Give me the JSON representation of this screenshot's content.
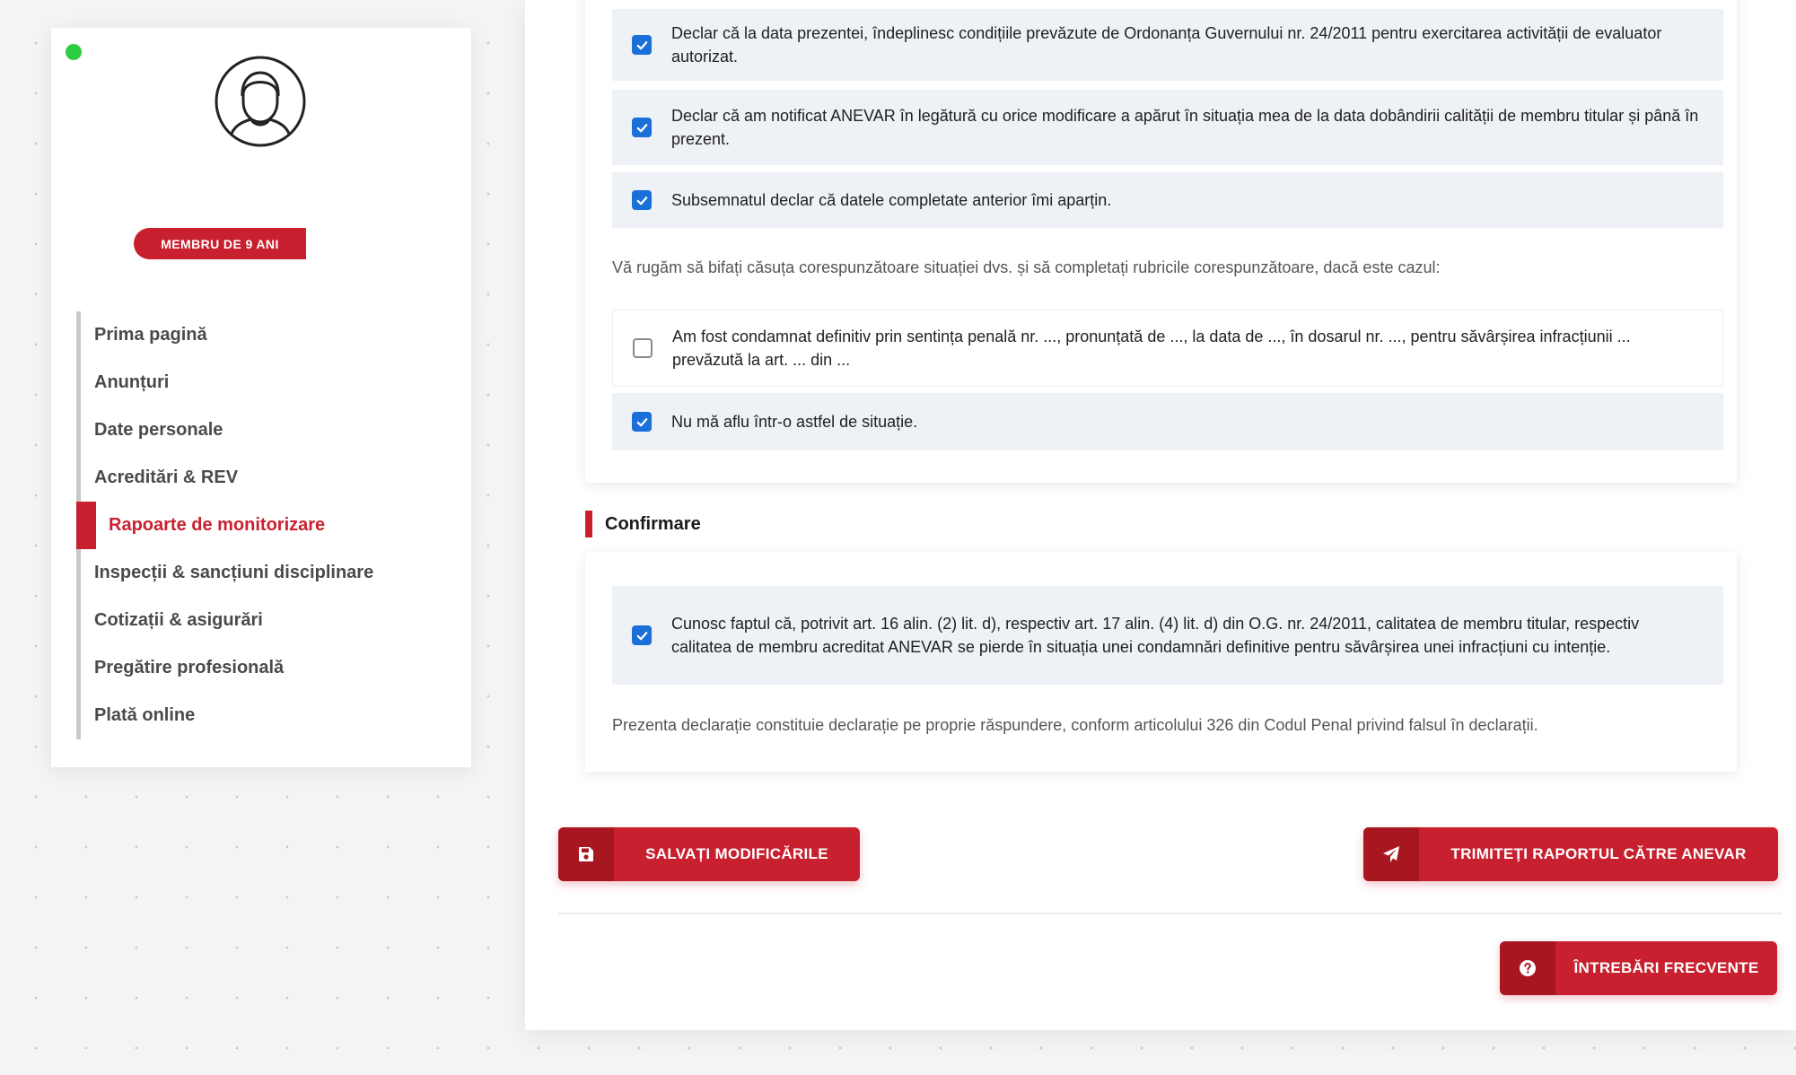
{
  "sidebar": {
    "badge": "MEMBRU DE 9 ANI",
    "items": [
      {
        "label": "Prima pagină"
      },
      {
        "label": "Anunțuri"
      },
      {
        "label": "Date personale"
      },
      {
        "label": "Acreditări & REV"
      },
      {
        "label": "Rapoarte de monitorizare",
        "active": true
      },
      {
        "label": "Inspecții & sancțiuni disciplinare"
      },
      {
        "label": "Cotizații & asigurări"
      },
      {
        "label": "Pregătire profesională"
      },
      {
        "label": "Plată online"
      }
    ]
  },
  "declarations": [
    {
      "text": "Declar că la data prezentei, îndeplinesc condițiile prevăzute de Ordonanța Guvernului nr. 24/2011 pentru exercitarea activității de evaluator autorizat.",
      "checked": true
    },
    {
      "text": "Declar că am notificat ANEVAR în legătură cu orice modificare a apărut în situația mea de la data dobândirii calității de membru titular și până în prezent.",
      "checked": true
    },
    {
      "text": "Subsemnatul declar că datele completate anterior îmi aparțin.",
      "checked": true
    }
  ],
  "instructions": "Vă rugăm să bifați căsuța corespunzătoare situației dvs. și să completați rubricile corespunzătoare, dacă este cazul:",
  "situations": [
    {
      "text": "Am fost condamnat definitiv prin sentința penală nr. ..., pronunțată de ..., la data de ..., în dosarul nr. ..., pentru săvârșirea infracțiunii ... prevăzută la art. ... din ...",
      "checked": false
    },
    {
      "text": "Nu mă aflu într-o astfel de situație.",
      "checked": true
    }
  ],
  "confirmation": {
    "title": "Confirmare",
    "check_text": "Cunosc faptul că, potrivit art. 16 alin. (2) lit. d), respectiv art. 17 alin. (4) lit. d) din O.G. nr. 24/2011, calitatea de membru titular, respectiv calitatea de membru acreditat ANEVAR se pierde în situația unei condamnări definitive pentru săvârșirea unei infracțiuni cu intenție.",
    "checked": true,
    "note": "Prezenta declarație constituie declarație pe proprie răspundere, conform articolului 326 din Codul Penal privind falsul în declarații."
  },
  "buttons": {
    "save": "SALVAȚI MODIFICĂRILE",
    "send": "TRIMITEȚI RAPORTUL CĂTRE ANEVAR",
    "faq": "ÎNTREBĂRI FRECVENTE"
  },
  "colors": {
    "accent": "#c8202f",
    "checkbox": "#1a6fd8",
    "online": "#2ecc40"
  },
  "icons": {
    "save": "floppy-disk-icon",
    "send": "paper-plane-icon",
    "faq": "question-circle-icon",
    "check": "checkmark-icon",
    "avatar": "user-avatar-icon"
  }
}
